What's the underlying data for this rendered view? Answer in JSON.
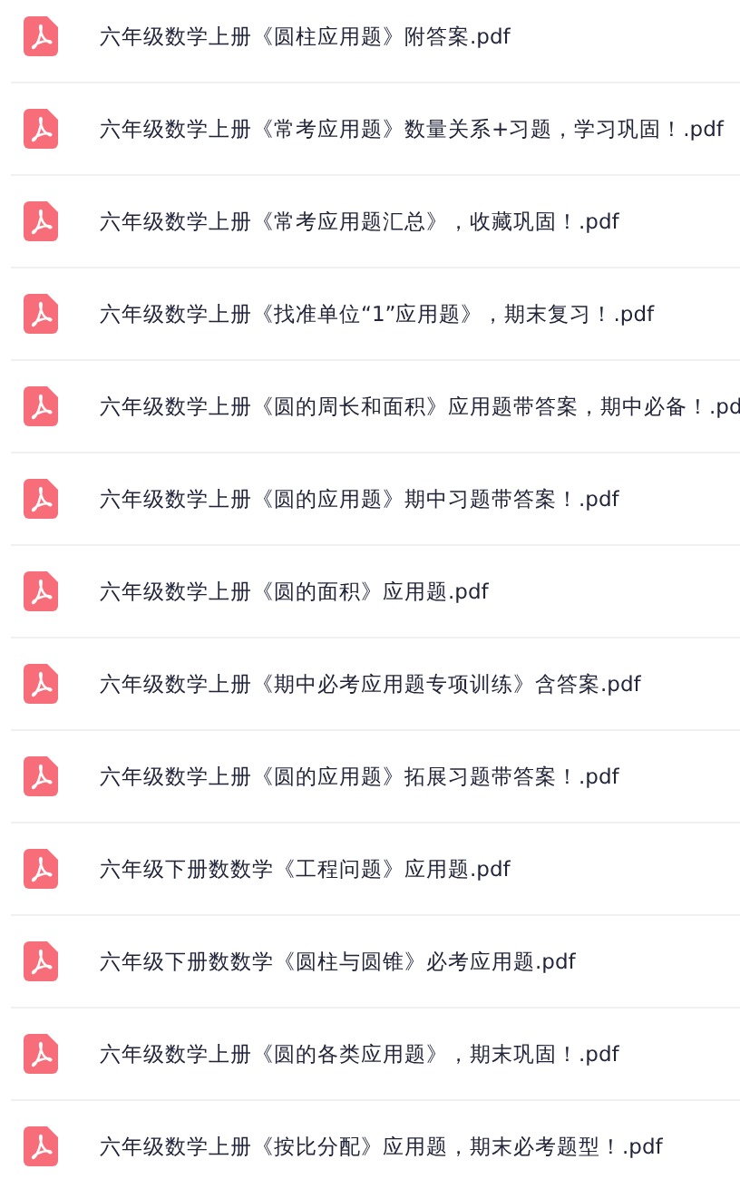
{
  "files": [
    {
      "name": "六年级数学上册《圆柱应用题》附答案.pdf"
    },
    {
      "name": "六年级数学上册《常考应用题》数量关系+习题，学习巩固！.pdf"
    },
    {
      "name": "六年级数学上册《常考应用题汇总》，收藏巩固！.pdf"
    },
    {
      "name": "六年级数学上册《找准单位“1”应用题》，期末复习！.pdf"
    },
    {
      "name": "六年级数学上册《圆的周长和面积》应用题带答案，期中必备！.pd"
    },
    {
      "name": "六年级数学上册《圆的应用题》期中习题带答案！.pdf"
    },
    {
      "name": "六年级数学上册《圆的面积》应用题.pdf"
    },
    {
      "name": "六年级数学上册《期中必考应用题专项训练》含答案.pdf"
    },
    {
      "name": "六年级数学上册《圆的应用题》拓展习题带答案！.pdf"
    },
    {
      "name": "六年级下册数数学《工程问题》应用题.pdf"
    },
    {
      "name": "六年级下册数数学《圆柱与圆锥》必考应用题.pdf"
    },
    {
      "name": "六年级数学上册《圆的各类应用题》，期末巩固！.pdf"
    },
    {
      "name": "六年级数学上册《按比分配》应用题，期末必考题型！.pdf"
    }
  ]
}
